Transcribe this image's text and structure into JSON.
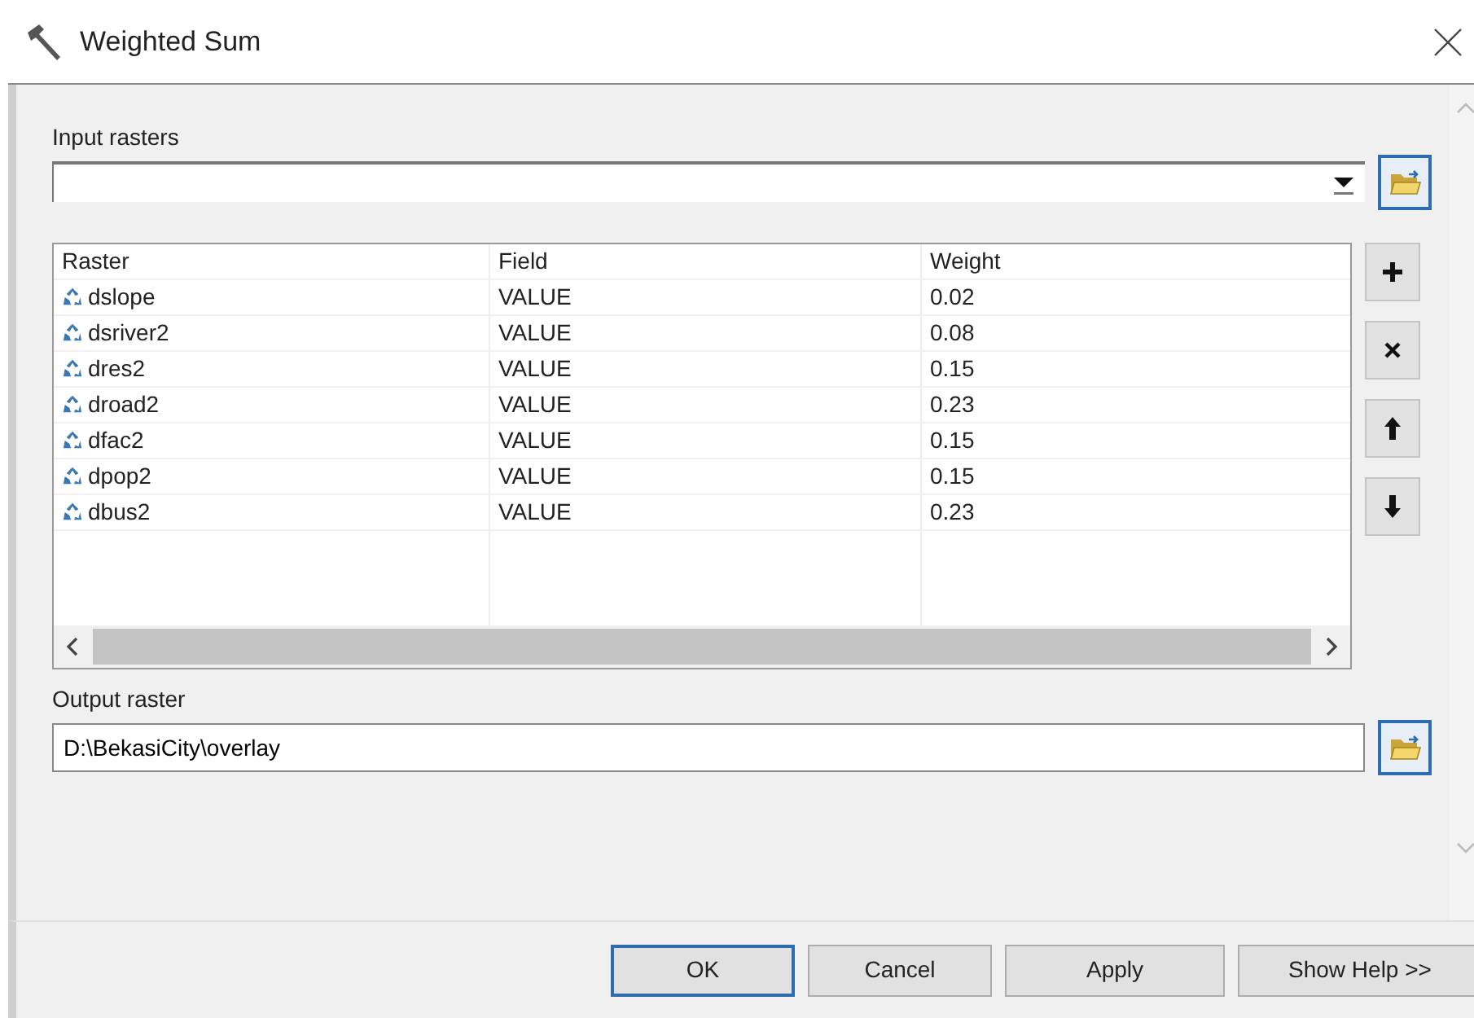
{
  "window": {
    "title": "Weighted Sum"
  },
  "input_rasters": {
    "label": "Input rasters"
  },
  "table": {
    "columns": [
      "Raster",
      "Field",
      "Weight"
    ],
    "rows": [
      {
        "raster": "dslope",
        "field": "VALUE",
        "weight": "0.02"
      },
      {
        "raster": "dsriver2",
        "field": "VALUE",
        "weight": "0.08"
      },
      {
        "raster": "dres2",
        "field": "VALUE",
        "weight": "0.15"
      },
      {
        "raster": "droad2",
        "field": "VALUE",
        "weight": "0.23"
      },
      {
        "raster": "dfac2",
        "field": "VALUE",
        "weight": "0.15"
      },
      {
        "raster": "dpop2",
        "field": "VALUE",
        "weight": "0.15"
      },
      {
        "raster": "dbus2",
        "field": "VALUE",
        "weight": "0.23"
      }
    ]
  },
  "output_raster": {
    "label": "Output raster",
    "value": "D:\\BekasiCity\\overlay"
  },
  "buttons": [
    {
      "label": "OK",
      "default": true
    },
    {
      "label": "Cancel",
      "default": false
    },
    {
      "label": "Apply",
      "default": false
    },
    {
      "label": "Show Help >>",
      "default": false
    }
  ]
}
